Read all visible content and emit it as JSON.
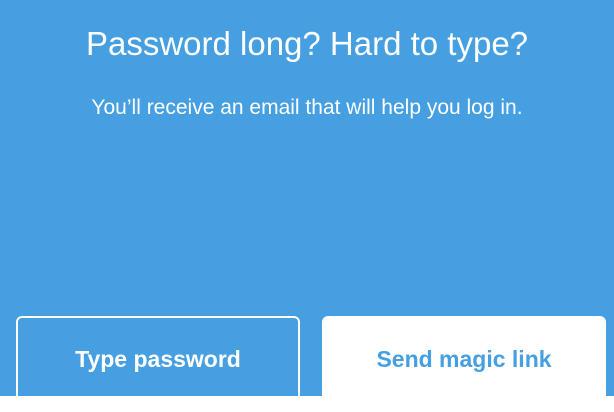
{
  "dialog": {
    "title": "Password long? Hard to type?",
    "subtitle": "You’ll receive an email that will help you log in.",
    "buttons": {
      "type_password": "Type password",
      "send_magic_link": "Send magic link"
    }
  },
  "colors": {
    "background": "#459fe0",
    "button_text_primary": "#459fe0",
    "foreground": "#ffffff"
  }
}
